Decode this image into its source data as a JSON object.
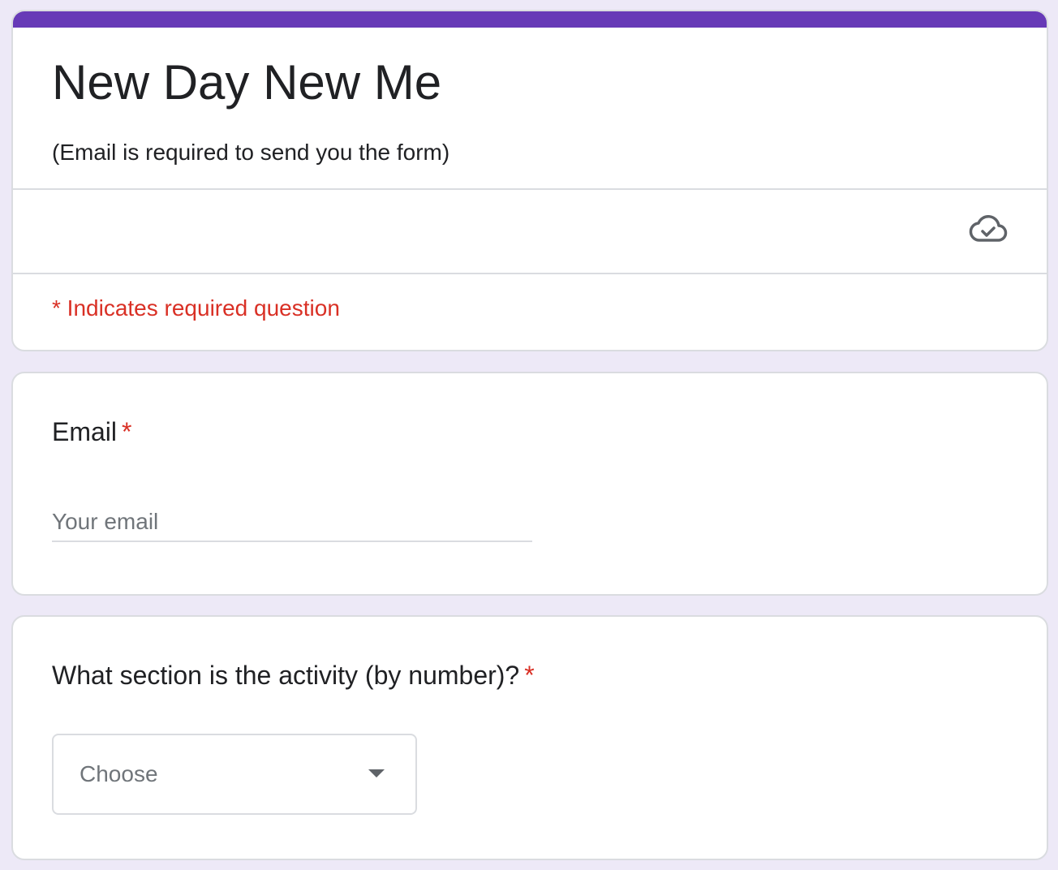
{
  "header": {
    "title": "New Day New Me",
    "description": "(Email is required to send you the form)",
    "saved_icon": "cloud-check-icon",
    "required_note": "* Indicates required question",
    "accent_color": "#673ab7"
  },
  "questions": [
    {
      "title": "Email",
      "required_marker": "*",
      "input": {
        "value": "",
        "placeholder": "Your email"
      }
    },
    {
      "title": "What section is the activity (by number)?",
      "required_marker": "*",
      "select": {
        "selected": "Choose",
        "icon": "caret-down-icon"
      }
    }
  ],
  "colors": {
    "background": "#ede9f7",
    "required": "#d93025",
    "border": "#dadce0",
    "placeholder": "#70757a"
  }
}
